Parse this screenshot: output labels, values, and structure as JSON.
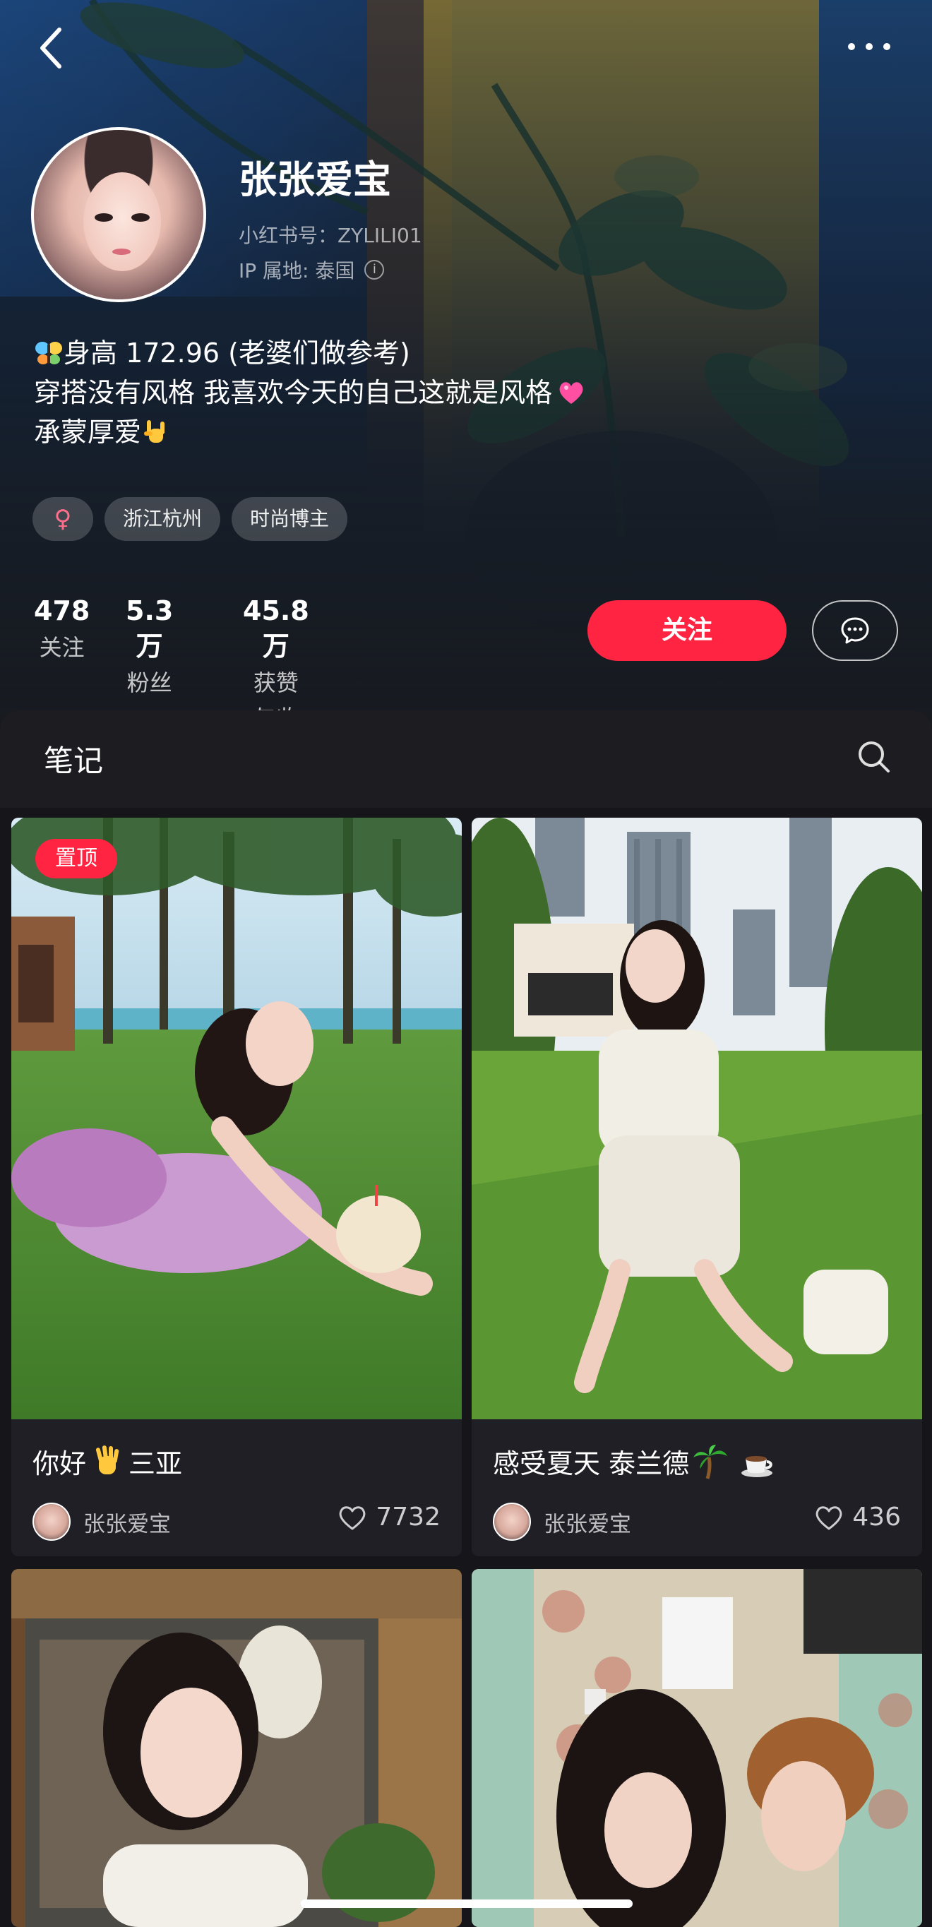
{
  "profile": {
    "name": "张张爱宝",
    "red_id": "小红书号：ZYLILI01",
    "ip": "IP 属地: 泰国",
    "bio_lines": [
      "身高 172.96 (老婆们做参考)",
      "穿搭没有风格  我喜欢今天的自己这就是风格",
      "承蒙厚爱"
    ],
    "tags": [
      "浙江杭州",
      "时尚博主"
    ],
    "gender_symbol": "♀",
    "stats": [
      {
        "value": "478",
        "label": "关注"
      },
      {
        "value": "5.3万",
        "label": "粉丝"
      },
      {
        "value": "45.8万",
        "label": "获赞与收藏"
      }
    ],
    "follow_label": "关注"
  },
  "notes": {
    "section_title": "笔记",
    "pin_label": "置顶",
    "cards": [
      {
        "title": "你好",
        "title_suffix": "三亚",
        "author": "张张爱宝",
        "likes": "7732"
      },
      {
        "title": "感受夏天 泰兰德",
        "title_suffix": "",
        "author": "张张爱宝",
        "likes": "436"
      }
    ]
  },
  "icons": {
    "back": "chevron-left-icon",
    "more": "more-dots-icon",
    "message": "chat-bubble-icon",
    "search": "search-icon",
    "like": "heart-outline-icon"
  },
  "colors": {
    "accent": "#ff2442",
    "background": "#16161a",
    "card": "#1f1f25"
  }
}
